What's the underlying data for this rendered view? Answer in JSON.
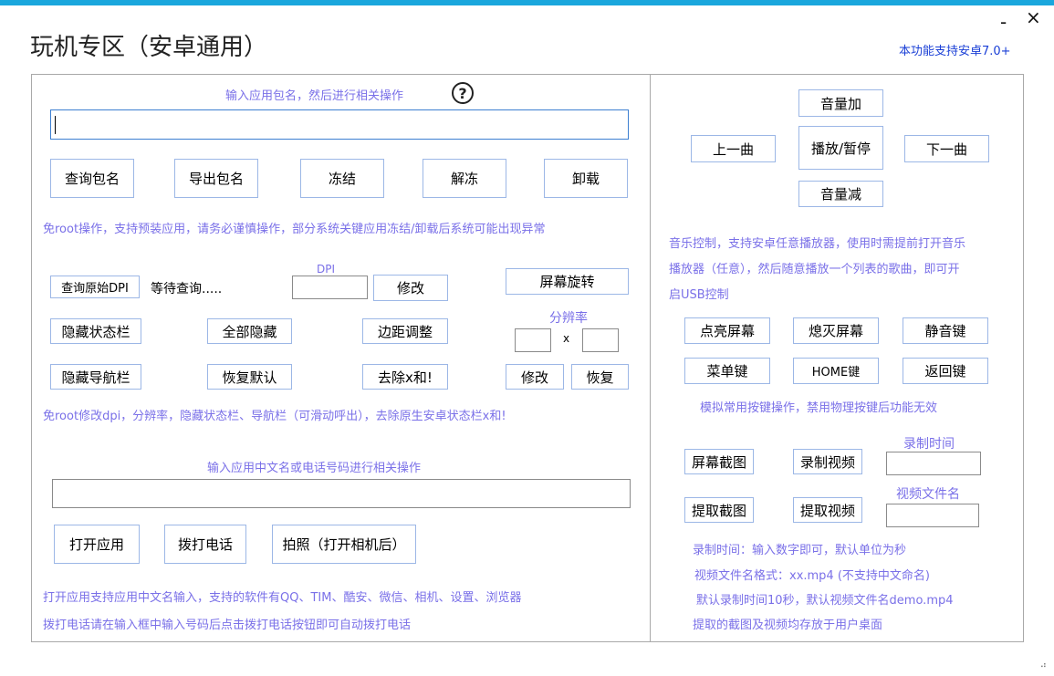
{
  "window": {
    "title": "玩机专区（安卓通用）",
    "minimize": "-",
    "close": "×",
    "support_note": "本功能支持安卓7.0+",
    "accent": "#1aa7dd"
  },
  "left": {
    "package_prompt": "输入应用包名，然后进行相关操作",
    "help_icon": "?",
    "package_value": "",
    "package_buttons": [
      "查询包名",
      "导出包名",
      "冻结",
      "解冻",
      "卸载"
    ],
    "root_note": "免root操作，支持预装应用，请务必谨慎操作，部分系统关键应用冻结/卸载后系统可能出现异常",
    "dpi_query_button": "查询原始DPI",
    "dpi_status": "等待查询.....",
    "dpi_label": "DPI",
    "dpi_value": "",
    "dpi_modify_button": "修改",
    "rotate_button": "屏幕旋转",
    "hide_status_bar": "隐藏状态栏",
    "hide_all": "全部隐藏",
    "margin_adjust": "边距调整",
    "resolution_label": "分辨率",
    "resolution_x": "x",
    "hide_nav_bar": "隐藏导航栏",
    "restore_default": "恢复默认",
    "remove_x_and": "去除x和!",
    "res_modify_button": "修改",
    "res_restore_button": "恢复",
    "dpi_note": "免root修改dpi，分辨率，隐藏状态栏、导航栏（可滑动呼出），去除原生安卓状态栏x和!",
    "app_prompt": "输入应用中文名或电话号码进行相关操作",
    "app_value": "",
    "open_app": "打开应用",
    "dial": "拨打电话",
    "photo": "拍照（打开相机后）",
    "app_note1": "打开应用支持应用中文名输入，支持的软件有QQ、TIM、酷安、微信、相机、设置、浏览器",
    "app_note2": "拨打电话请在输入框中输入号码后点击拨打电话按钮即可自动拨打电话"
  },
  "right": {
    "vol_up": "音量加",
    "prev": "上一曲",
    "play_pause": "播放/暂停",
    "next": "下一曲",
    "vol_down": "音量减",
    "music_note1": "音乐控制，支持安卓任意播放器，使用时需提前打开音乐",
    "music_note2": "播放器（任意），然后随意播放一个列表的歌曲，即可开",
    "music_note3": "启USB控制",
    "light_screen": "点亮屏幕",
    "off_screen": "熄灭屏幕",
    "mute_key": "静音键",
    "menu_key": "菜单键",
    "home_key": "HOME键",
    "back_key": "返回键",
    "key_note": "模拟常用按键操作，禁用物理按键后功能无效",
    "record_time_label": "录制时间",
    "screenshot": "屏幕截图",
    "record_video": "录制视频",
    "record_time_value": "",
    "video_name_label": "视频文件名",
    "pull_screenshot": "提取截图",
    "pull_video": "提取视频",
    "video_name_value": "",
    "rec_note1": "录制时间：输入数字即可，默认单位为秒",
    "rec_note2": "视频文件名格式：xx.mp4 (不支持中文命名)",
    "rec_note3": "默认录制时间10秒，默认视频文件名demo.mp4",
    "rec_note4": "提取的截图及视频均存放于用户桌面"
  }
}
